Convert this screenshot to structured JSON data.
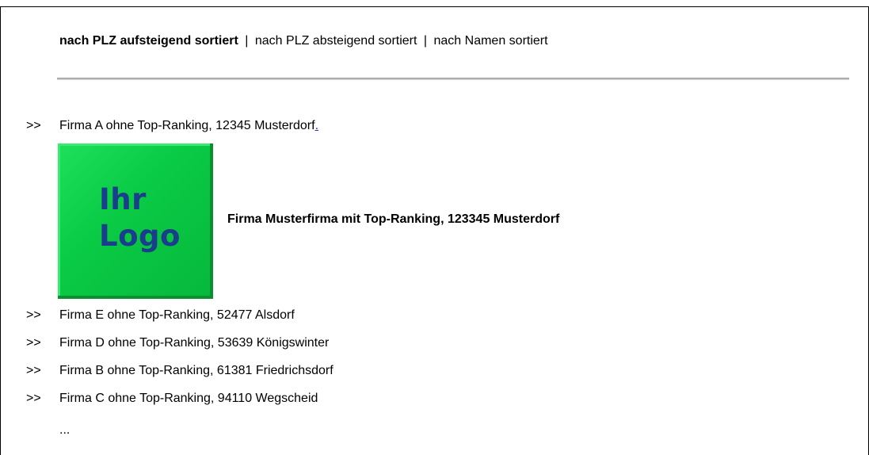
{
  "sort": {
    "asc_label": "nach PLZ aufsteigend sortiert",
    "separator": "|",
    "desc_label": "nach PLZ absteigend sortiert",
    "name_label": "nach Namen sortiert"
  },
  "arrow": ">>",
  "entries": [
    {
      "text": "Firma A ohne Top-Ranking, 12345 Musterdorf",
      "suffix": "."
    },
    {
      "text": "Firma E ohne Top-Ranking, 52477 Alsdorf"
    },
    {
      "text": "Firma D ohne Top-Ranking, 53639 Königswinter"
    },
    {
      "text": "Firma B ohne Top-Ranking, 61381 Friedrichsdorf"
    },
    {
      "text": "Firma C ohne Top-Ranking, 94110 Wegscheid"
    }
  ],
  "featured": {
    "logo_line1": "Ihr",
    "logo_line2": "Logo",
    "text": "Firma Musterfirma mit Top-Ranking, 123345 Musterdorf"
  },
  "more": "..."
}
